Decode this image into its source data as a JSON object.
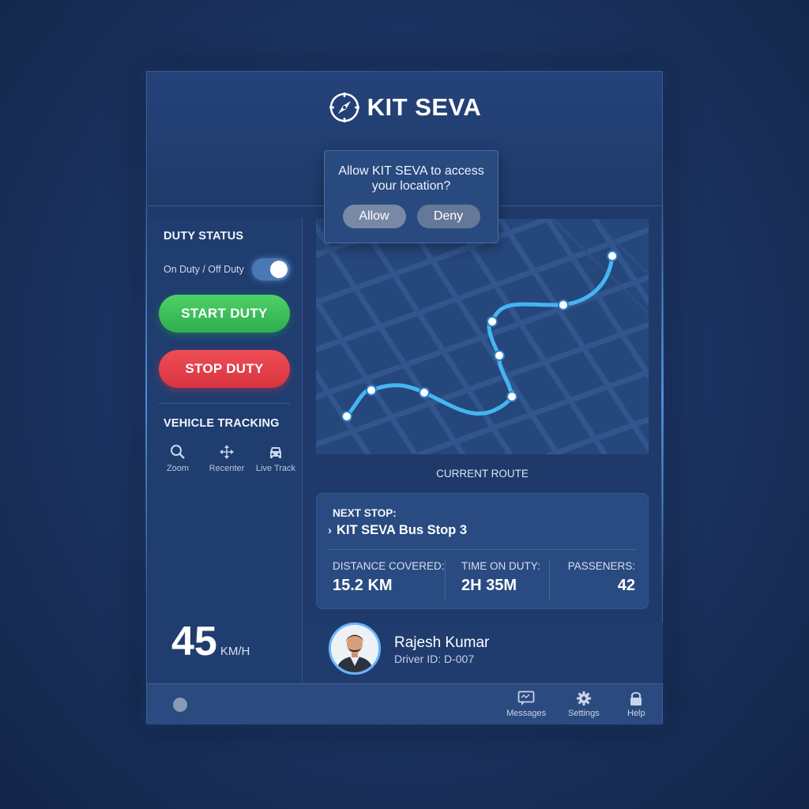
{
  "app": {
    "title": "KIT SEVA"
  },
  "permission": {
    "question": "Allow KIT SEVA to access your location?",
    "allow": "Allow",
    "deny": "Deny"
  },
  "sidebar": {
    "duty_status_title": "DUTY STATUS",
    "toggle_label": "On Duty / Off Duty",
    "toggle_on": true,
    "start_label": "START DUTY",
    "stop_label": "STOP DUTY",
    "tracking_title": "VEHICLE TRACKING",
    "tools": [
      {
        "label": "Zoom",
        "icon": "search-icon"
      },
      {
        "label": "Recenter",
        "icon": "recenter-icon"
      },
      {
        "label": "Live Track",
        "icon": "car-icon"
      }
    ],
    "speed": {
      "value": "45",
      "unit": "KM/H"
    }
  },
  "map": {
    "caption": "CURRENT ROUTE"
  },
  "trip": {
    "next_stop_title": "NEXT STOP:",
    "next_stop": "KIT SEVA Bus Stop 3",
    "stats": [
      {
        "label": "DISTANCE COVERED:",
        "value": "15.2 KM"
      },
      {
        "label": "TIME ON DUTY:",
        "value": "2H 35M"
      },
      {
        "label": "PASSENERS:",
        "value": "42"
      }
    ]
  },
  "driver": {
    "name": "Rajesh Kumar",
    "id": "Driver ID: D-007"
  },
  "nav": [
    {
      "label": "Messages",
      "icon": "message-icon"
    },
    {
      "label": "Settings",
      "icon": "gear-icon"
    },
    {
      "label": "Help",
      "icon": "lock-icon"
    }
  ],
  "colors": {
    "accent": "#4fb8f5",
    "start": "#3cc25a",
    "stop": "#e0404a",
    "panel": "#1f3a6a"
  }
}
